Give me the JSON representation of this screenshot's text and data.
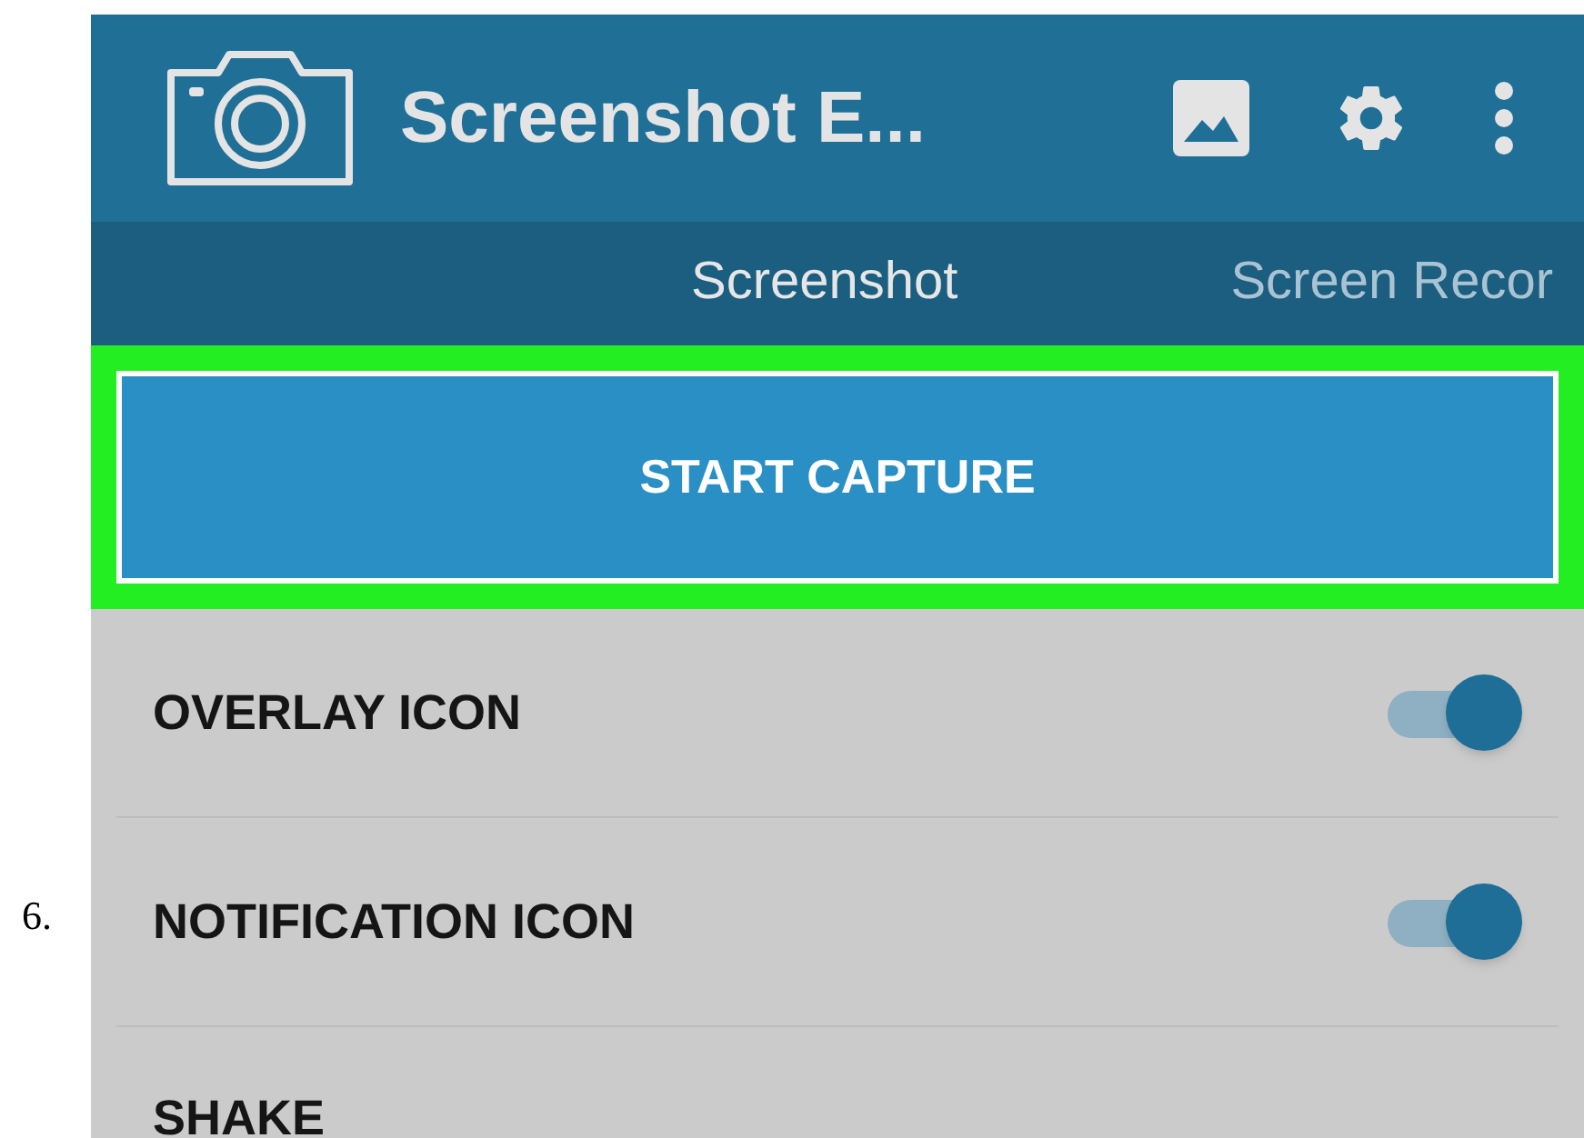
{
  "step_number": "6.",
  "app_bar": {
    "title": "Screenshot E..."
  },
  "tabs": [
    {
      "label": "Screenshot",
      "selected": true
    },
    {
      "label": "Screen Recor",
      "selected": false
    }
  ],
  "capture_button": {
    "label": "START CAPTURE"
  },
  "settings": [
    {
      "label": "OVERLAY ICON",
      "on": true
    },
    {
      "label": "NOTIFICATION ICON",
      "on": true
    },
    {
      "label": "SHAKE"
    }
  ]
}
